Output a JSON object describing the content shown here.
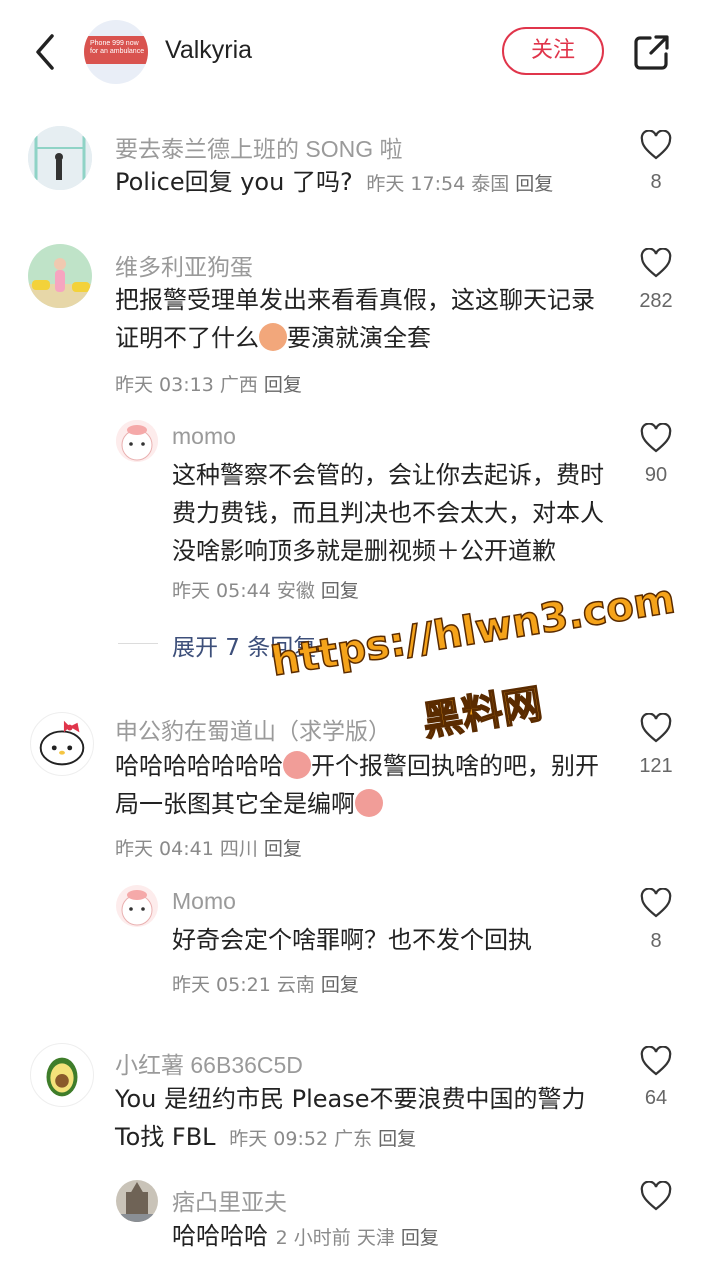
{
  "header": {
    "title": "Valkyria",
    "follow_label": "关注",
    "avatar_text": "Phone 999 now for an ambulance"
  },
  "comments": [
    {
      "user": "要去泰兰德上班的 SONG 啦",
      "text": "Police回复 you 了吗?",
      "time": "昨天 17:54",
      "location": "泰国",
      "reply": "回复",
      "likes": "8"
    },
    {
      "user": "维多利亚狗蛋",
      "text_a": "把报警受理单发出来看看真假，这这聊天记录证明不了什么",
      "text_b": "要演就演全套",
      "time": "昨天 03:13",
      "location": "广西",
      "reply": "回复",
      "likes": "282",
      "replies": [
        {
          "user": "momo",
          "text": "这种警察不会管的，会让你去起诉，费时费力费钱，而且判决也不会太大，对本人没啥影响顶多就是删视频＋公开道歉",
          "time": "昨天 05:44",
          "location": "安徽",
          "reply": "回复",
          "likes": "90"
        }
      ],
      "expand_label": "展开 7 条回复"
    },
    {
      "user": "申公豹在蜀道山（求学版）",
      "text_a": "哈哈哈哈哈哈哈",
      "text_b": "开个报警回执啥的吧，别开局一张图其它全是编啊",
      "time": "昨天 04:41",
      "location": "四川",
      "reply": "回复",
      "likes": "121",
      "replies": [
        {
          "user": "Momo",
          "text": "好奇会定个啥罪啊？也不发个回执",
          "time": "昨天 05:21",
          "location": "云南",
          "reply": "回复",
          "likes": "8"
        }
      ]
    },
    {
      "user": "小红薯 66B36C5D",
      "text_a": "You 是纽约市民 Please不要浪费中国的警力",
      "text_b": "To找 FBL",
      "time": "昨天 09:52",
      "location": "广东",
      "reply": "回复",
      "likes": "64",
      "replies": [
        {
          "user": "痞凸里亚夫",
          "text": "哈哈哈哈",
          "time": "2 小时前",
          "location": "天津",
          "reply": "回复",
          "likes": ""
        }
      ]
    }
  ],
  "watermark": {
    "url": "https://hlwn3.com",
    "name": "黑料网"
  },
  "colors": {
    "accent": "#e0354b",
    "link": "#3d4f7a",
    "watermark": "#f5a31a"
  }
}
